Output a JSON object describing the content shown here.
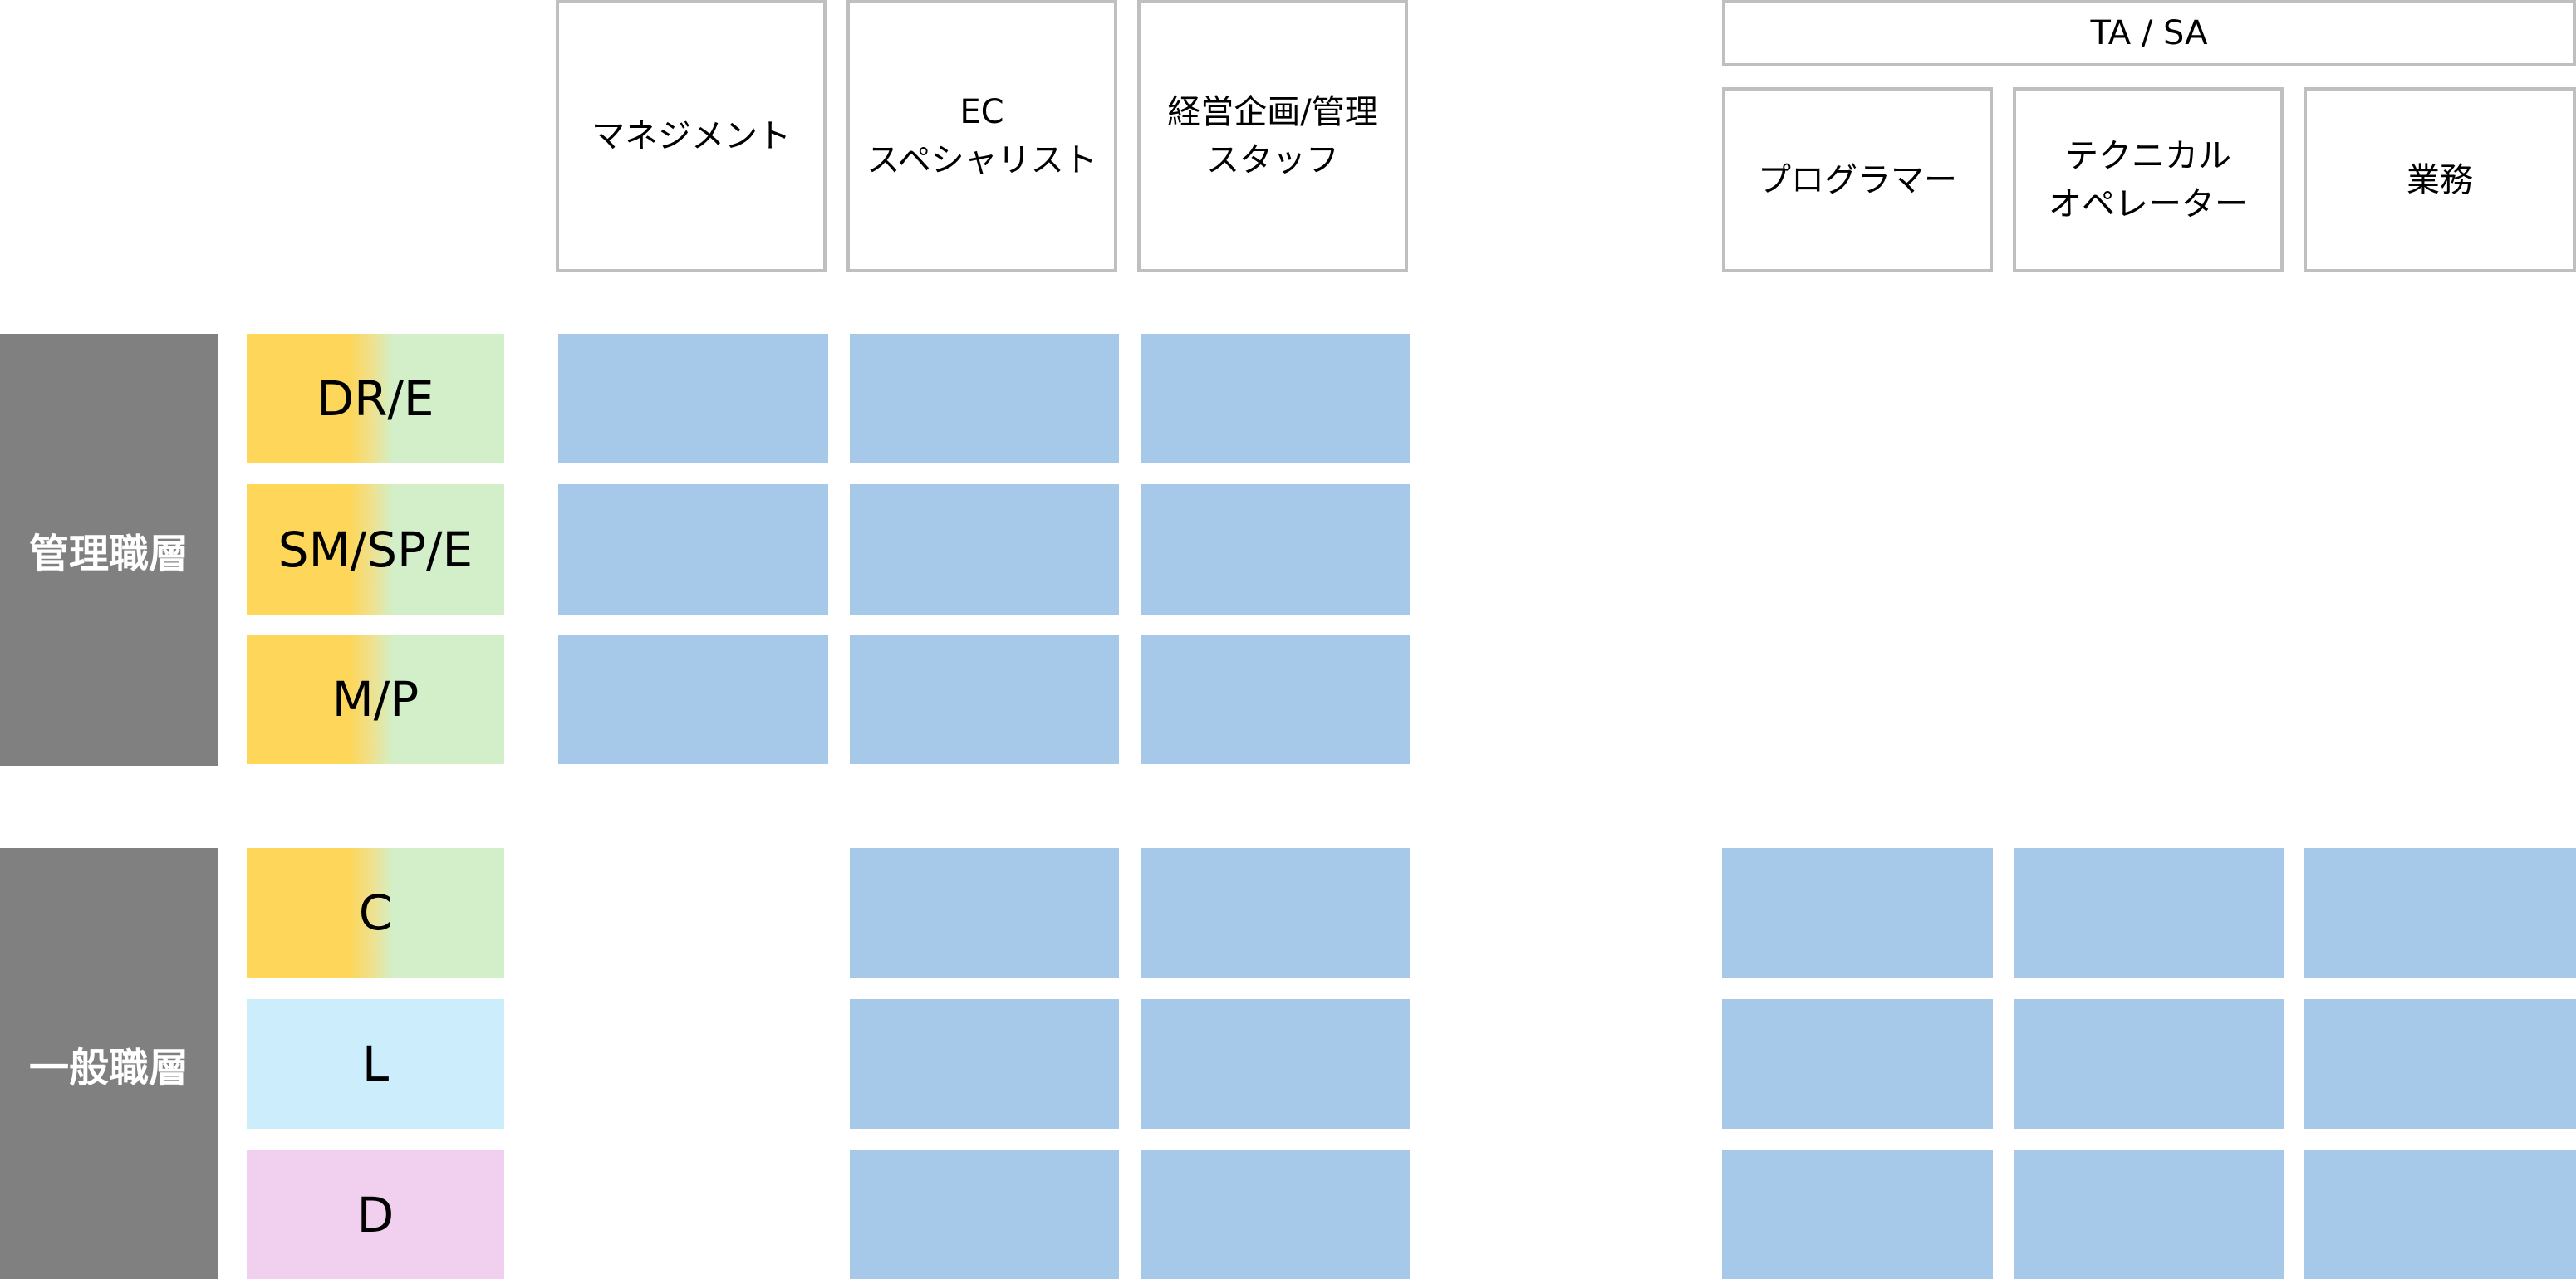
{
  "columns": [
    {
      "label": "マネジメント"
    },
    {
      "label": "EC\nスペシャリスト"
    },
    {
      "label": "経営企画/管理\nスタッフ"
    }
  ],
  "group_header": {
    "label": "TA / SA",
    "columns": [
      {
        "label": "プログラマー"
      },
      {
        "label": "テクニカル\nオペレーター"
      },
      {
        "label": "業務"
      }
    ]
  },
  "tiers": [
    {
      "label": "管理職層",
      "grades": [
        "DR/E",
        "SM/SP/E",
        "M/P"
      ]
    },
    {
      "label": "一般職層",
      "grades": [
        "C",
        "L",
        "D"
      ]
    }
  ],
  "colors": {
    "tier_bg": "#808080",
    "grade_yellow": "#fdd65a",
    "grade_green": "#d2efc9",
    "grade_light_blue": "#ccedfb",
    "grade_pink": "#f1cfee",
    "cell_blue": "#a6c9ea",
    "header_border": "#bfbfbf"
  }
}
